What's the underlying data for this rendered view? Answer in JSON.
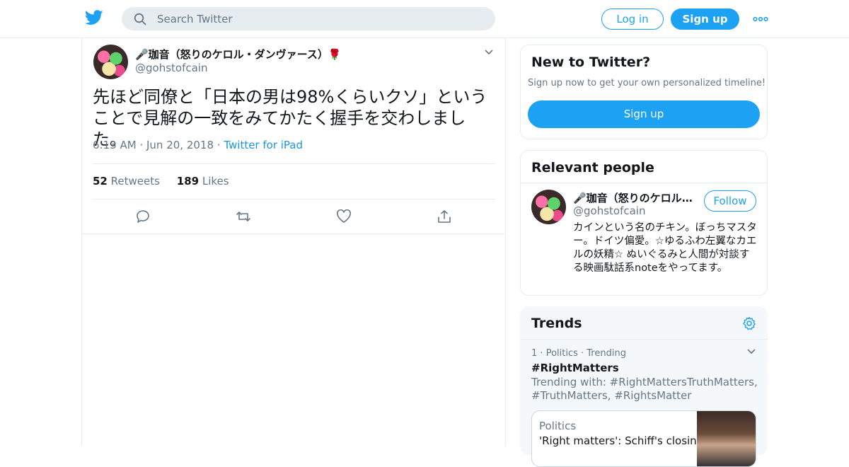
{
  "header": {
    "search_placeholder": "Search Twitter",
    "login_label": "Log in",
    "signup_label": "Sign up",
    "brand_color": "#1da1f2"
  },
  "tweet": {
    "author_name": "🎤珈音（怒りのケロル・ダンヴァース）🌹",
    "author_handle": "@gohstofcain",
    "text": "先ほど同僚と「日本の男は98%くらいクソ」ということで見解の一致をみてかたく握手を交わしました。",
    "time": "6:13 AM",
    "date": "Jun 20, 2018",
    "source": "Twitter for iPad",
    "retweets_count": "52",
    "retweets_label": "Retweets",
    "likes_count": "189",
    "likes_label": "Likes"
  },
  "sidebar": {
    "new_title": "New to Twitter?",
    "new_subtitle": "Sign up now to get your own personalized timeline!",
    "new_button": "Sign up",
    "relevant_title": "Relevant people",
    "person": {
      "name": "🎤珈音（怒りのケロル・ダンヴァース）🌹",
      "handle": "@gohstofcain",
      "follow_label": "Follow",
      "bio": "カインという名のチキン。ぼっちマスター。ドイツ偏愛。☆ゆるふわ左翼なカエルの妖精☆ ぬいぐるみと人間が対談する映画駄話系noteをやってます。"
    },
    "trends_title": "Trends",
    "trend": {
      "rank": "1",
      "category": "Politics",
      "status": "Trending",
      "tag": "#RightMatters",
      "with": "Trending with: #RightMattersTruthMatters, #TruthMatters, #RightsMatter"
    },
    "news": {
      "category": "Politics",
      "headline": "'Right matters': Schiff's closing"
    }
  }
}
